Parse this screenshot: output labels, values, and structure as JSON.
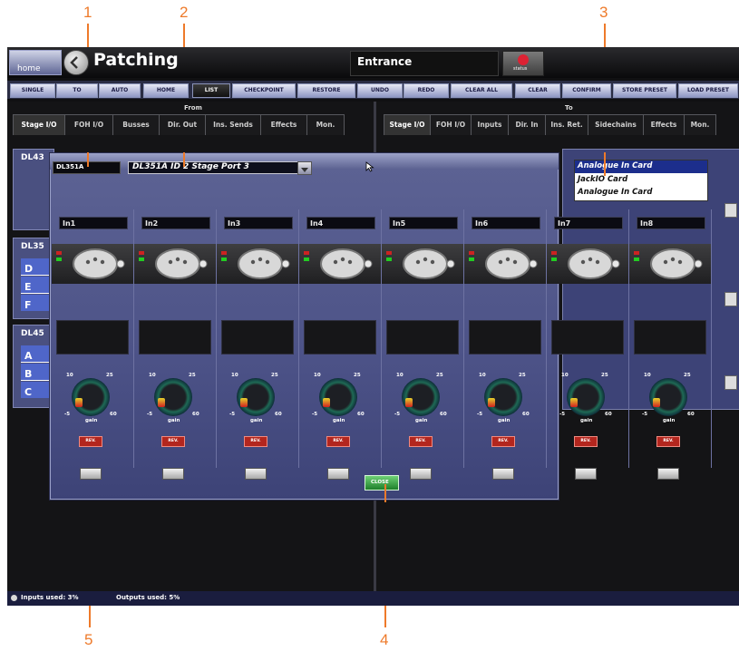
{
  "app": {
    "home_label": "home",
    "title": "Patching",
    "scene": "Entrance",
    "status_label": "status"
  },
  "toolbar": {
    "single": "SINGLE",
    "multi": "TO",
    "auto": "AUTO",
    "home": "HOME",
    "list": "LIST",
    "checkpoint": "CHECKPOINT",
    "restore": "RESTORE",
    "undo": "UNDO",
    "redo": "REDO",
    "clear_all": "CLEAR ALL",
    "clear": "CLEAR",
    "confirm": "CONFIRM",
    "store_preset": "STORE PRESET",
    "load_preset": "LOAD PRESET"
  },
  "from_panel": {
    "heading": "From",
    "tabs": [
      "Stage I/O",
      "FOH I/O",
      "Busses",
      "Dir. Out",
      "Ins. Sends",
      "Effects",
      "Mon."
    ]
  },
  "to_panel": {
    "heading": "To",
    "tabs": [
      "Stage I/O",
      "FOH I/O",
      "Inputs",
      "Dir. In",
      "Ins. Ret.",
      "Sidechains",
      "Effects",
      "Mon."
    ]
  },
  "left_rack": {
    "groups": [
      {
        "label": "DL43",
        "letters": []
      },
      {
        "label": "DL35",
        "letters": [
          "D",
          "E",
          "F"
        ]
      },
      {
        "label": "DL45",
        "letters": [
          "A",
          "B",
          "C"
        ]
      }
    ]
  },
  "modal": {
    "device": "DL351A",
    "port_select": "DL351A ID 2 Stage Port 3",
    "card_dropdown": {
      "options": [
        "Analogue In Card",
        "JackIO Card",
        "Analogue In Card"
      ],
      "selected_index": 0
    },
    "channels": [
      {
        "name": "In1"
      },
      {
        "name": "In2"
      },
      {
        "name": "In3"
      },
      {
        "name": "In4"
      },
      {
        "name": "In5"
      },
      {
        "name": "In6"
      },
      {
        "name": "In7"
      },
      {
        "name": "In8"
      }
    ],
    "knob_labels": {
      "low": "10",
      "high": "25",
      "min": "-5",
      "max": "60",
      "caption": "gain"
    },
    "rev_label": "REV.",
    "close_label": "CLOSE"
  },
  "status_bar": {
    "inputs_used": "Inputs used: 3%",
    "outputs_used": "Outputs used: 5%"
  },
  "callouts": [
    "1",
    "2",
    "3",
    "4",
    "5"
  ],
  "colors": {
    "callout": "#ee7a2a",
    "modal_blue": "#4c5287",
    "rev_red": "#b3261e",
    "close_green": "#2f9c3a",
    "dropdown_selected": "#1c2e8c"
  }
}
